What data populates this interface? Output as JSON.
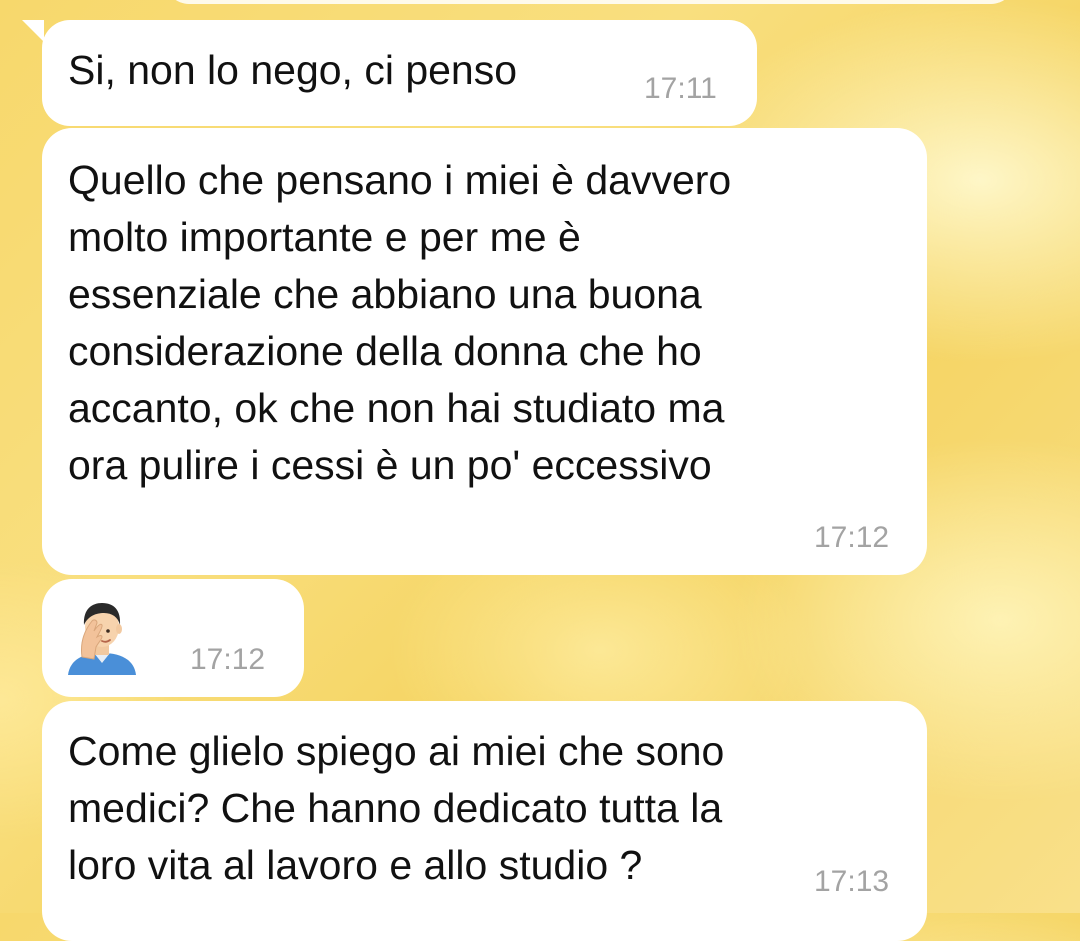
{
  "chat": {
    "messages": [
      {
        "text": "Si, non lo nego, ci penso",
        "time": "17:11"
      },
      {
        "text": "Quello che pensano i miei è davvero\nmolto importante e per me è\nessenziale che abbiano una buona\nconsiderazione della donna che ho\naccanto, ok che non hai studiato ma\nora pulire i cessi è un po' eccessivo",
        "time": "17:12"
      },
      {
        "emoji": "man-facepalming",
        "time": "17:12"
      },
      {
        "text": "Come glielo spiego ai miei che sono\nmedici? Che hanno dedicato tutta la\nloro vita al lavoro e allo studio ?",
        "time": "17:13"
      }
    ]
  },
  "colors": {
    "bubble": "#ffffff",
    "timestamp": "#a3a3a3",
    "text": "#111111",
    "wallpaper": "#f7d86c"
  }
}
